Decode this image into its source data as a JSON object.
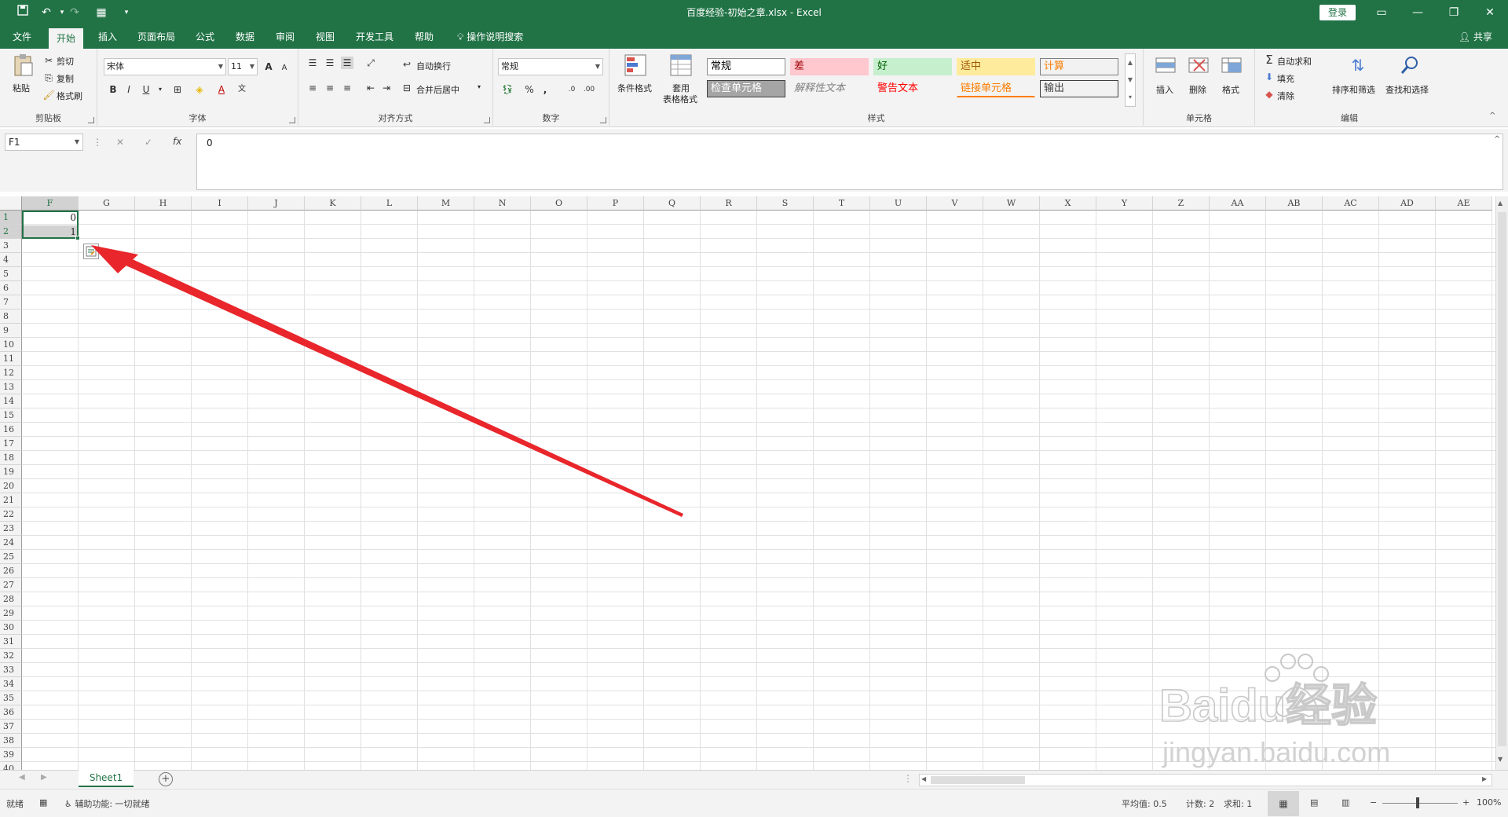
{
  "title_bar": {
    "doc_title": "百度经验-初始之章.xlsx  -  Excel",
    "sign_in": "登录",
    "quick_access": [
      "save",
      "undo",
      "redo",
      "form",
      "customize"
    ]
  },
  "tabs": [
    "文件",
    "开始",
    "插入",
    "页面布局",
    "公式",
    "数据",
    "审阅",
    "视图",
    "开发工具",
    "帮助"
  ],
  "active_tab": "开始",
  "tell_me": "操作说明搜索",
  "share": "共享",
  "ribbon": {
    "clipboard": {
      "paste": "粘贴",
      "cut": "剪切",
      "copy": "复制",
      "format_painter": "格式刷",
      "label": "剪贴板"
    },
    "font": {
      "name": "宋体",
      "size": "11",
      "bold": "B",
      "italic": "I",
      "underline": "U",
      "grow": "A",
      "shrink": "A",
      "font_color": "A",
      "label": "字体"
    },
    "alignment": {
      "wrap": "自动换行",
      "merge": "合并后居中",
      "label": "对齐方式"
    },
    "number": {
      "format": "常规",
      "percent": "%",
      "comma": ",",
      "label": "数字"
    },
    "styles": {
      "conditional": "条件格式",
      "table_format_1": "套用",
      "table_format_2": "表格格式",
      "cells": [
        {
          "text": "常规",
          "bg": "#ffffff",
          "color": "#000000",
          "border": "#8e8e8e"
        },
        {
          "text": "差",
          "bg": "#ffc7ce",
          "color": "#9c0006",
          "border": "#ffc7ce"
        },
        {
          "text": "好",
          "bg": "#c6efce",
          "color": "#006100",
          "border": "#c6efce"
        },
        {
          "text": "适中",
          "bg": "#ffeb9c",
          "color": "#9c5700",
          "border": "#ffeb9c"
        },
        {
          "text": "计算",
          "bg": "#f2f2f2",
          "color": "#fa7d00",
          "border": "#7f7f7f"
        },
        {
          "text": "检查单元格",
          "bg": "#a5a5a5",
          "color": "#ffffff",
          "border": "#3f3f3f"
        },
        {
          "text": "解释性文本",
          "bg": "#f3f3f3",
          "color": "#7f7f7f",
          "border": "#f3f3f3"
        },
        {
          "text": "警告文本",
          "bg": "#f3f3f3",
          "color": "#ff0000",
          "border": "#f3f3f3"
        },
        {
          "text": "链接单元格",
          "bg": "#f3f3f3",
          "color": "#fa7d00",
          "border": "#f3f3f3"
        },
        {
          "text": "输出",
          "bg": "#f2f2f2",
          "color": "#3f3f3f",
          "border": "#3f3f3f"
        }
      ],
      "label": "样式"
    },
    "cells_group": {
      "insert": "插入",
      "delete": "删除",
      "format": "格式",
      "label": "单元格"
    },
    "editing": {
      "autosum": "自动求和",
      "fill": "填充",
      "clear": "清除",
      "sort": "排序和筛选",
      "find": "查找和选择",
      "label": "编辑"
    }
  },
  "formula_bar": {
    "name_box": "F1",
    "cancel": "✕",
    "enter": "✓",
    "fx": "fx",
    "value": "0"
  },
  "columns": [
    "F",
    "G",
    "H",
    "I",
    "J",
    "K",
    "L",
    "M",
    "N",
    "O",
    "P",
    "Q",
    "R",
    "S",
    "T",
    "U",
    "V",
    "W",
    "X",
    "Y",
    "Z",
    "AA",
    "AB",
    "AC",
    "AD",
    "AE"
  ],
  "rows": [
    "1",
    "2",
    "3",
    "4",
    "5",
    "6",
    "7",
    "8",
    "9",
    "10",
    "11",
    "12",
    "13",
    "14",
    "15",
    "16",
    "17",
    "18",
    "19",
    "20",
    "21",
    "22",
    "23",
    "24",
    "25",
    "26",
    "27",
    "28",
    "29",
    "30",
    "31",
    "32",
    "33",
    "34",
    "35",
    "36",
    "37",
    "38",
    "39",
    "40"
  ],
  "cells": {
    "F1": "0",
    "F2": "1"
  },
  "sheet_tab": "Sheet1",
  "status": {
    "ready": "就绪",
    "accessibility": "辅助功能: 一切就绪",
    "average": "平均值: 0.5",
    "count": "计数: 2",
    "sum": "求和: 1",
    "zoom": "100%"
  },
  "watermark": {
    "brand": "Baidu经验",
    "url": "jingyan.baidu.com"
  },
  "colors": {
    "excel_green": "#217346",
    "arrow_red": "#e8262b"
  }
}
